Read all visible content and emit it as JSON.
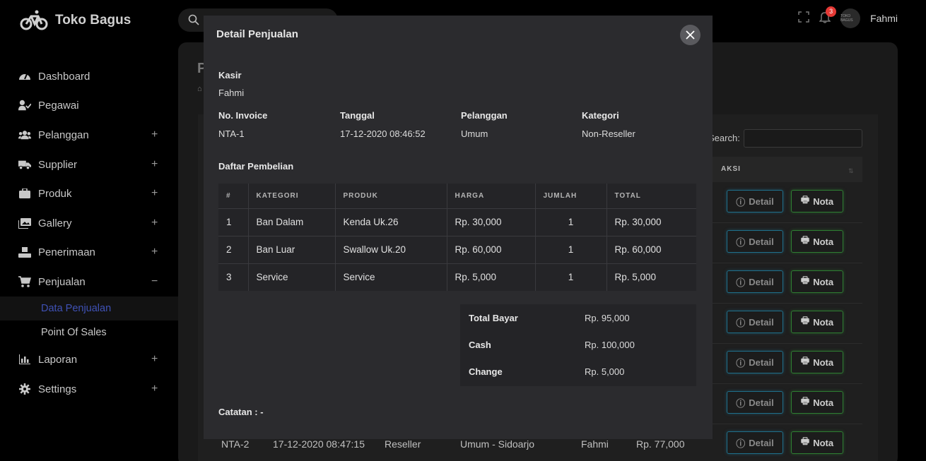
{
  "brand": {
    "name": "Toko Bagus"
  },
  "sidebar": {
    "items": [
      {
        "label": "Dashboard",
        "icon": "dashboard-icon",
        "expand": ""
      },
      {
        "label": "Pegawai",
        "icon": "user-check-icon",
        "expand": ""
      },
      {
        "label": "Pelanggan",
        "icon": "users-icon",
        "expand": "+"
      },
      {
        "label": "Supplier",
        "icon": "truck-icon",
        "expand": "+"
      },
      {
        "label": "Produk",
        "icon": "briefcase-icon",
        "expand": "+"
      },
      {
        "label": "Gallery",
        "icon": "images-icon",
        "expand": "+"
      },
      {
        "label": "Penerimaan",
        "icon": "box-receive-icon",
        "expand": "+"
      },
      {
        "label": "Penjualan",
        "icon": "cart-icon",
        "expand": "−"
      },
      {
        "label": "Laporan",
        "icon": "chart-bar-icon",
        "expand": "+"
      },
      {
        "label": "Settings",
        "icon": "gear-icon",
        "expand": "+"
      }
    ],
    "submenu": [
      {
        "label": "Data Penjualan",
        "active": true
      },
      {
        "label": "Point Of Sales",
        "active": false
      }
    ]
  },
  "topbar": {
    "notif_count": "3",
    "avatar_text": "TOKO BAGUS",
    "username": "Fahmi"
  },
  "background": {
    "title_initial": "P",
    "search_label": "Search:",
    "aksi_header": "AKSI",
    "detail_label": "Detail",
    "nota_label": "Nota",
    "last_row": {
      "invoice": "NTA-2",
      "tanggal": "17-12-2020 08:47:15",
      "kategori": "Reseller",
      "pelanggan": "Umum - Sidoarjo",
      "kasir": "Fahmi",
      "total": "Rp. 77,000"
    }
  },
  "modal": {
    "title": "Detail Penjualan",
    "kasir_label": "Kasir",
    "kasir_value": "Fahmi",
    "invoice_label": "No. Invoice",
    "invoice_value": "NTA-1",
    "tanggal_label": "Tanggal",
    "tanggal_value": "17-12-2020 08:46:52",
    "pelanggan_label": "Pelanggan",
    "pelanggan_value": "Umum",
    "kategori_label": "Kategori",
    "kategori_value": "Non-Reseller",
    "daftar_label": "Daftar Pembelian",
    "table": {
      "headers": [
        "#",
        "KATEGORI",
        "PRODUK",
        "HARGA",
        "JUMLAH",
        "TOTAL"
      ],
      "rows": [
        [
          "1",
          "Ban Dalam",
          "Kenda Uk.26",
          "Rp. 30,000",
          "1",
          "Rp. 30,000"
        ],
        [
          "2",
          "Ban Luar",
          "Swallow Uk.20",
          "Rp. 60,000",
          "1",
          "Rp. 60,000"
        ],
        [
          "3",
          "Service",
          "Service",
          "Rp. 5,000",
          "1",
          "Rp. 5,000"
        ]
      ]
    },
    "summary": {
      "total_label": "Total Bayar",
      "total_value": "Rp. 95,000",
      "cash_label": "Cash",
      "cash_value": "Rp. 100,000",
      "change_label": "Change",
      "change_value": "Rp. 5,000"
    },
    "catatan": "Catatan : -"
  }
}
